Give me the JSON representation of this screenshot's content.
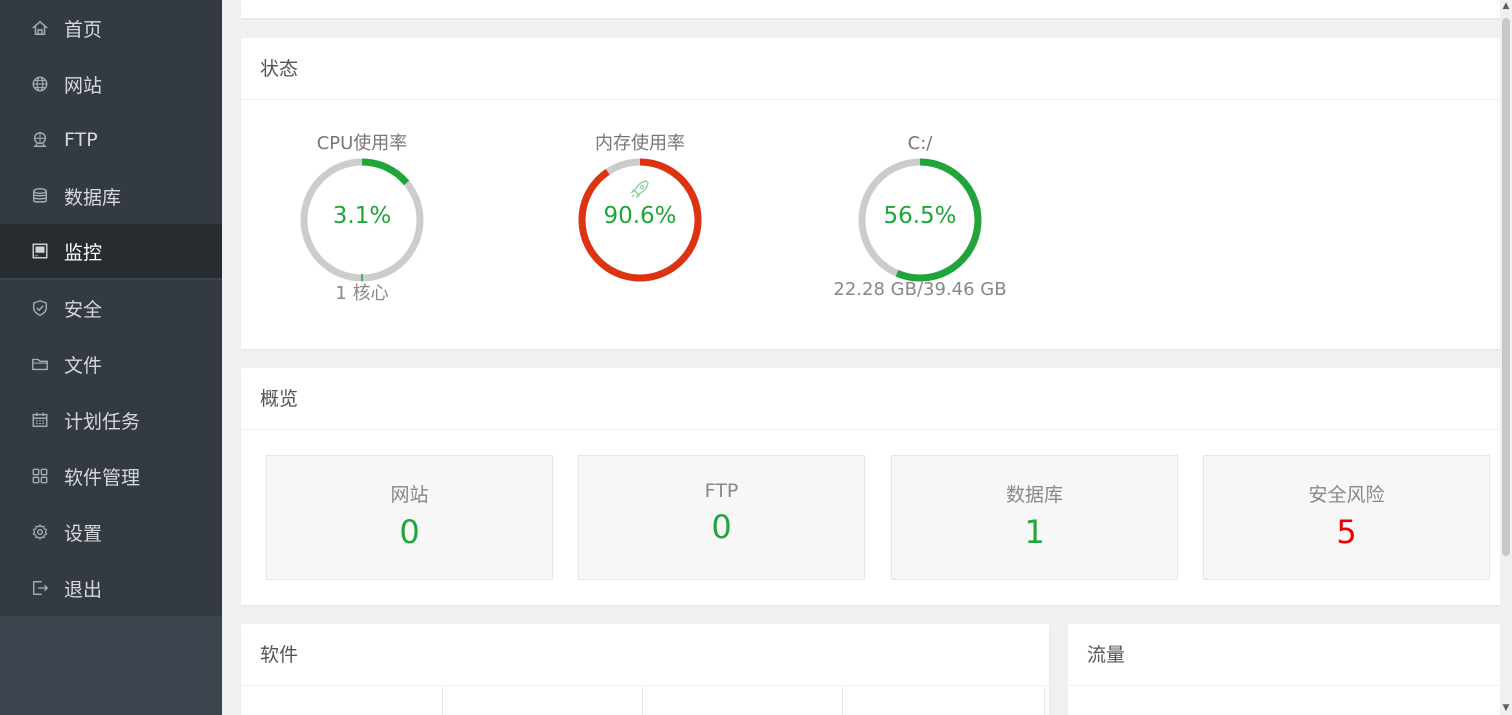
{
  "sidebar": {
    "items": [
      {
        "label": "首页",
        "icon": "home-icon"
      },
      {
        "label": "网站",
        "icon": "globe-icon"
      },
      {
        "label": "FTP",
        "icon": "ftp-icon"
      },
      {
        "label": "数据库",
        "icon": "database-icon"
      },
      {
        "label": "监控",
        "icon": "monitor-icon",
        "active": true
      },
      {
        "label": "安全",
        "icon": "shield-icon"
      },
      {
        "label": "文件",
        "icon": "folder-icon"
      },
      {
        "label": "计划任务",
        "icon": "calendar-icon"
      },
      {
        "label": "软件管理",
        "icon": "apps-grid-icon"
      },
      {
        "label": "设置",
        "icon": "gear-icon"
      },
      {
        "label": "退出",
        "icon": "logout-icon"
      }
    ]
  },
  "status": {
    "title": "状态",
    "cpu": {
      "title": "CPU使用率",
      "value": "3.1%",
      "percent": 3.1,
      "sub": "1 核心",
      "color": "#20a53a"
    },
    "memory": {
      "title": "内存使用率",
      "value": "90.6%",
      "percent": 90.6,
      "sub": "",
      "color": "#dd3311",
      "icon": "rocket-icon"
    },
    "disk": {
      "title": "C:/",
      "value": "56.5%",
      "percent": 56.5,
      "sub": "22.28 GB/39.46 GB",
      "color": "#20a53a"
    }
  },
  "overview": {
    "title": "概览",
    "cards": [
      {
        "label": "网站",
        "count": "0",
        "danger": false
      },
      {
        "label": "FTP",
        "count": "0",
        "danger": false
      },
      {
        "label": "数据库",
        "count": "1",
        "danger": false
      },
      {
        "label": "安全风险",
        "count": "5",
        "danger": true
      }
    ]
  },
  "software": {
    "title": "软件"
  },
  "traffic": {
    "title": "流量"
  },
  "colors": {
    "accent": "#20a53a",
    "danger": "#ee0000",
    "sidebar": "#333a41",
    "sidebar_active": "#272c31"
  }
}
